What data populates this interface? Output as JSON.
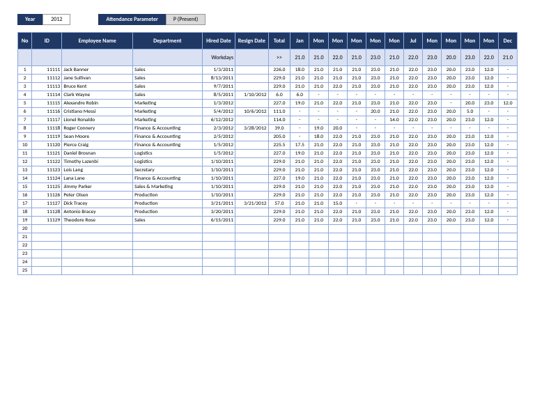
{
  "top": {
    "year_label": "Year",
    "year_value": "2012",
    "attendance_label": "Attendance Parameter",
    "attendance_value": "P (Present)"
  },
  "headers": [
    "No",
    "ID",
    "Employee Name",
    "Department",
    "Hired Date",
    "Resign Date",
    "Total",
    "Jan",
    "Mon",
    "Mon",
    "Mon",
    "Mon",
    "Mon",
    "Jul",
    "Mon",
    "Mon",
    "Mon",
    "Mon",
    "Dec"
  ],
  "subhead": {
    "workdays_label": "Workdays",
    "arrow": ">>",
    "months": [
      "21.0",
      "21.0",
      "22.0",
      "21.0",
      "23.0",
      "21.0",
      "22.0",
      "23.0",
      "20.0",
      "23.0",
      "22.0",
      "21.0"
    ]
  },
  "rows": [
    {
      "no": "1",
      "id": "11111",
      "name": "Jack Banner",
      "dept": "Sales",
      "hired": "1/3/2011",
      "resign": "",
      "total": "226.0",
      "m": [
        "18.0",
        "21.0",
        "21.0",
        "21.0",
        "23.0",
        "21.0",
        "22.0",
        "23.0",
        "20.0",
        "23.0",
        "12.0",
        "-"
      ]
    },
    {
      "no": "2",
      "id": "11112",
      "name": "Jane Sullivan",
      "dept": "Sales",
      "hired": "8/13/2011",
      "resign": "",
      "total": "229.0",
      "m": [
        "21.0",
        "21.0",
        "21.0",
        "21.0",
        "23.0",
        "21.0",
        "22.0",
        "23.0",
        "20.0",
        "23.0",
        "12.0",
        "-"
      ]
    },
    {
      "no": "3",
      "id": "11113",
      "name": "Bruce Kent",
      "dept": "Sales",
      "hired": "9/7/2011",
      "resign": "",
      "total": "229.0",
      "m": [
        "21.0",
        "21.0",
        "22.0",
        "21.0",
        "23.0",
        "21.0",
        "22.0",
        "23.0",
        "20.0",
        "23.0",
        "12.0",
        "-"
      ]
    },
    {
      "no": "4",
      "id": "11114",
      "name": "Clark Wayne",
      "dept": "Sales",
      "hired": "8/5/2011",
      "resign": "1/10/2012",
      "total": "6.0",
      "m": [
        "6.0",
        "-",
        "-",
        "-",
        "-",
        "-",
        "-",
        "-",
        "-",
        "-",
        "-",
        "-"
      ]
    },
    {
      "no": "5",
      "id": "11115",
      "name": "Alexandre Robin",
      "dept": "Marketing",
      "hired": "1/3/2012",
      "resign": "",
      "total": "227.0",
      "m": [
        "19.0",
        "21.0",
        "22.0",
        "21.0",
        "23.0",
        "21.0",
        "22.0",
        "23.0",
        "-",
        "20.0",
        "23.0",
        "12.0"
      ]
    },
    {
      "no": "6",
      "id": "11116",
      "name": "Cristiano Messi",
      "dept": "Marketing",
      "hired": "5/4/2012",
      "resign": "10/6/2012",
      "total": "111.0",
      "m": [
        "-",
        "-",
        "-",
        "-",
        "20.0",
        "21.0",
        "22.0",
        "23.0",
        "20.0",
        "5.0",
        "-",
        "-"
      ]
    },
    {
      "no": "7",
      "id": "11117",
      "name": "Lionel Ronaldo",
      "dept": "Marketing",
      "hired": "6/12/2012",
      "resign": "",
      "total": "114.0",
      "m": [
        "-",
        "-",
        "-",
        "-",
        "-",
        "14.0",
        "22.0",
        "23.0",
        "20.0",
        "23.0",
        "12.0",
        "-"
      ]
    },
    {
      "no": "8",
      "id": "11118",
      "name": "Roger Connery",
      "dept": "Finance & Accounting",
      "hired": "2/3/2012",
      "resign": "3/28/2012",
      "total": "39.0",
      "m": [
        "-",
        "19.0",
        "20.0",
        "-",
        "-",
        "-",
        "-",
        "-",
        "-",
        "-",
        "-",
        "-"
      ]
    },
    {
      "no": "9",
      "id": "11119",
      "name": "Sean Moore",
      "dept": "Finance & Accounting",
      "hired": "2/5/2012",
      "resign": "",
      "total": "205.0",
      "m": [
        "-",
        "18.0",
        "22.0",
        "21.0",
        "23.0",
        "21.0",
        "22.0",
        "23.0",
        "20.0",
        "23.0",
        "12.0",
        "-"
      ]
    },
    {
      "no": "10",
      "id": "11120",
      "name": "Pierce Craig",
      "dept": "Finance & Accounting",
      "hired": "1/5/2012",
      "resign": "",
      "total": "225.5",
      "m": [
        "17.5",
        "21.0",
        "22.0",
        "21.0",
        "23.0",
        "21.0",
        "22.0",
        "23.0",
        "20.0",
        "23.0",
        "12.0",
        "-"
      ]
    },
    {
      "no": "11",
      "id": "11121",
      "name": "Daniel Brosnan",
      "dept": "Logistics",
      "hired": "1/5/2012",
      "resign": "",
      "total": "227.0",
      "m": [
        "19.0",
        "21.0",
        "22.0",
        "21.0",
        "23.0",
        "21.0",
        "22.0",
        "23.0",
        "20.0",
        "23.0",
        "12.0",
        "-"
      ]
    },
    {
      "no": "12",
      "id": "11122",
      "name": "Timothy Lazenbi",
      "dept": "Logistics",
      "hired": "1/10/2011",
      "resign": "",
      "total": "229.0",
      "m": [
        "21.0",
        "21.0",
        "22.0",
        "21.0",
        "23.0",
        "21.0",
        "22.0",
        "23.0",
        "20.0",
        "23.0",
        "12.0",
        "-"
      ]
    },
    {
      "no": "13",
      "id": "11123",
      "name": "Lois Lang",
      "dept": "Secretary",
      "hired": "1/10/2011",
      "resign": "",
      "total": "229.0",
      "m": [
        "21.0",
        "21.0",
        "22.0",
        "21.0",
        "23.0",
        "21.0",
        "22.0",
        "23.0",
        "20.0",
        "23.0",
        "12.0",
        "-"
      ]
    },
    {
      "no": "14",
      "id": "11124",
      "name": "Lana Lane",
      "dept": "Finance & Accounting",
      "hired": "1/10/2011",
      "resign": "",
      "total": "227.0",
      "m": [
        "19.0",
        "21.0",
        "22.0",
        "21.0",
        "23.0",
        "21.0",
        "22.0",
        "23.0",
        "20.0",
        "23.0",
        "12.0",
        "-"
      ]
    },
    {
      "no": "15",
      "id": "11125",
      "name": "Jimmy Parker",
      "dept": "Sales & Marketing",
      "hired": "1/10/2011",
      "resign": "",
      "total": "229.0",
      "m": [
        "21.0",
        "21.0",
        "22.0",
        "21.0",
        "23.0",
        "21.0",
        "22.0",
        "23.0",
        "20.0",
        "23.0",
        "12.0",
        "-"
      ]
    },
    {
      "no": "16",
      "id": "11126",
      "name": "Peter Olsen",
      "dept": "Production",
      "hired": "1/10/2011",
      "resign": "",
      "total": "229.0",
      "m": [
        "21.0",
        "21.0",
        "22.0",
        "21.0",
        "23.0",
        "21.0",
        "22.0",
        "23.0",
        "20.0",
        "23.0",
        "12.0",
        "-"
      ]
    },
    {
      "no": "17",
      "id": "11127",
      "name": "Dick Tracey",
      "dept": "Production",
      "hired": "3/21/2011",
      "resign": "3/21/2012",
      "total": "57.0",
      "m": [
        "21.0",
        "21.0",
        "15.0",
        "-",
        "-",
        "-",
        "-",
        "-",
        "-",
        "-",
        "-",
        "-"
      ]
    },
    {
      "no": "18",
      "id": "11128",
      "name": "Antonio Bracey",
      "dept": "Production",
      "hired": "3/20/2011",
      "resign": "",
      "total": "229.0",
      "m": [
        "21.0",
        "21.0",
        "22.0",
        "21.0",
        "23.0",
        "21.0",
        "22.0",
        "23.0",
        "20.0",
        "23.0",
        "12.0",
        "-"
      ]
    },
    {
      "no": "19",
      "id": "11129",
      "name": "Theodore Rose",
      "dept": "Sales",
      "hired": "6/15/2011",
      "resign": "",
      "total": "229.0",
      "m": [
        "21.0",
        "21.0",
        "22.0",
        "21.0",
        "23.0",
        "21.0",
        "22.0",
        "23.0",
        "20.0",
        "23.0",
        "12.0",
        "-"
      ]
    }
  ],
  "empty_rows": [
    "20",
    "21",
    "22",
    "23",
    "24",
    "25"
  ]
}
